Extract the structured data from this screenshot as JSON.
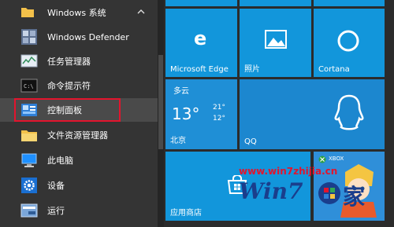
{
  "section": {
    "label": "Windows 系统",
    "collapse_icon": "chevron-up-icon"
  },
  "apps": [
    {
      "name": "app-windows-defender",
      "label": "Windows Defender",
      "icon": "shield-icon"
    },
    {
      "name": "app-task-manager",
      "label": "任务管理器",
      "icon": "task-manager-icon"
    },
    {
      "name": "app-cmd",
      "label": "命令提示符",
      "icon": "terminal-icon"
    },
    {
      "name": "app-control-panel",
      "label": "控制面板",
      "icon": "control-panel-icon"
    },
    {
      "name": "app-file-explorer",
      "label": "文件资源管理器",
      "icon": "folder-icon"
    },
    {
      "name": "app-this-pc",
      "label": "此电脑",
      "icon": "computer-icon"
    },
    {
      "name": "app-settings",
      "label": "设备",
      "icon": "gear-icon"
    },
    {
      "name": "app-run",
      "label": "运行",
      "icon": "run-icon"
    }
  ],
  "tiles": {
    "edge": {
      "label": "Microsoft Edge"
    },
    "photos": {
      "label": "照片"
    },
    "cortana": {
      "label": "Cortana"
    },
    "weather": {
      "condition": "多云",
      "temp": "13°",
      "high": "21°",
      "low": "12°",
      "city": "北京"
    },
    "qq": {
      "label": "QQ"
    },
    "store": {
      "label": "应用商店"
    },
    "xbox": {
      "label": "XBOX"
    }
  },
  "watermark": {
    "url": "www.win7zhijia.cn",
    "brand_a": "Win7",
    "brand_b": "家"
  },
  "colors": {
    "tile": "#1296db",
    "selected_outline": "#e3142d"
  }
}
